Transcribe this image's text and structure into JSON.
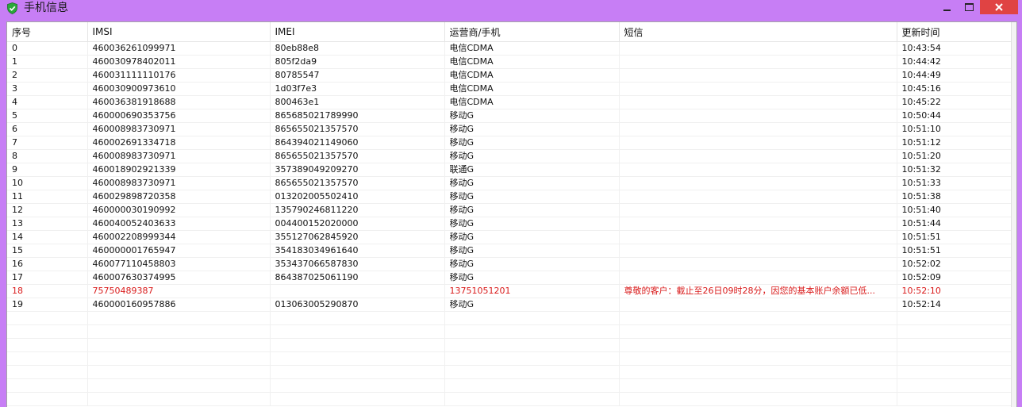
{
  "window": {
    "title": "手机信息",
    "colors": {
      "frame": "#c77ef5",
      "close": "#e04343",
      "highlight_text": "#d91a1a"
    }
  },
  "table": {
    "columns": [
      "序号",
      "IMSI",
      "IMEI",
      "运营商/手机",
      "短信",
      "更新时间"
    ],
    "rows": [
      {
        "idx": "0",
        "imsi": "460036261099971",
        "imei": "80eb88e8",
        "carrier": "电信CDMA",
        "sms": "",
        "time": "10:43:54"
      },
      {
        "idx": "1",
        "imsi": "460030978402011",
        "imei": "805f2da9",
        "carrier": "电信CDMA",
        "sms": "",
        "time": "10:44:42"
      },
      {
        "idx": "2",
        "imsi": "460031111110176",
        "imei": "80785547",
        "carrier": "电信CDMA",
        "sms": "",
        "time": "10:44:49"
      },
      {
        "idx": "3",
        "imsi": "460030900973610",
        "imei": "1d03f7e3",
        "carrier": "电信CDMA",
        "sms": "",
        "time": "10:45:16"
      },
      {
        "idx": "4",
        "imsi": "460036381918688",
        "imei": "800463e1",
        "carrier": "电信CDMA",
        "sms": "",
        "time": "10:45:22"
      },
      {
        "idx": "5",
        "imsi": "460000690353756",
        "imei": "865685021789990",
        "carrier": "移动G",
        "sms": "",
        "time": "10:50:44"
      },
      {
        "idx": "6",
        "imsi": "460008983730971",
        "imei": "865655021357570",
        "carrier": "移动G",
        "sms": "",
        "time": "10:51:10"
      },
      {
        "idx": "7",
        "imsi": "460002691334718",
        "imei": "864394021149060",
        "carrier": "移动G",
        "sms": "",
        "time": "10:51:12"
      },
      {
        "idx": "8",
        "imsi": "460008983730971",
        "imei": "865655021357570",
        "carrier": "移动G",
        "sms": "",
        "time": "10:51:20"
      },
      {
        "idx": "9",
        "imsi": "460018902921339",
        "imei": "357389049209270",
        "carrier": "联通G",
        "sms": "",
        "time": "10:51:32"
      },
      {
        "idx": "10",
        "imsi": "460008983730971",
        "imei": "865655021357570",
        "carrier": "移动G",
        "sms": "",
        "time": "10:51:33"
      },
      {
        "idx": "11",
        "imsi": "460029898720358",
        "imei": "013202005502410",
        "carrier": "移动G",
        "sms": "",
        "time": "10:51:38"
      },
      {
        "idx": "12",
        "imsi": "460000030190992",
        "imei": "135790246811220",
        "carrier": "移动G",
        "sms": "",
        "time": "10:51:40"
      },
      {
        "idx": "13",
        "imsi": "460040052403633",
        "imei": "004400152020000",
        "carrier": "移动G",
        "sms": "",
        "time": "10:51:44"
      },
      {
        "idx": "14",
        "imsi": "460002208999344",
        "imei": "355127062845920",
        "carrier": "移动G",
        "sms": "",
        "time": "10:51:51"
      },
      {
        "idx": "15",
        "imsi": "460000001765947",
        "imei": "354183034961640",
        "carrier": "移动G",
        "sms": "",
        "time": "10:51:51"
      },
      {
        "idx": "16",
        "imsi": "460077110458803",
        "imei": "353437066587830",
        "carrier": "移动G",
        "sms": "",
        "time": "10:52:02"
      },
      {
        "idx": "17",
        "imsi": "460007630374995",
        "imei": "864387025061190",
        "carrier": "移动G",
        "sms": "",
        "time": "10:52:09"
      },
      {
        "idx": "18",
        "imsi": "75750489387",
        "imei": "",
        "carrier": "13751051201",
        "sms": "尊敬的客户：截止至26日09时28分，因您的基本账户余额已低...",
        "time": "10:52:10"
      },
      {
        "idx": "19",
        "imsi": "460000160957886",
        "imei": "013063005290870",
        "carrier": "移动G",
        "sms": "",
        "time": "10:52:14"
      }
    ],
    "highlighted_row": 18
  }
}
